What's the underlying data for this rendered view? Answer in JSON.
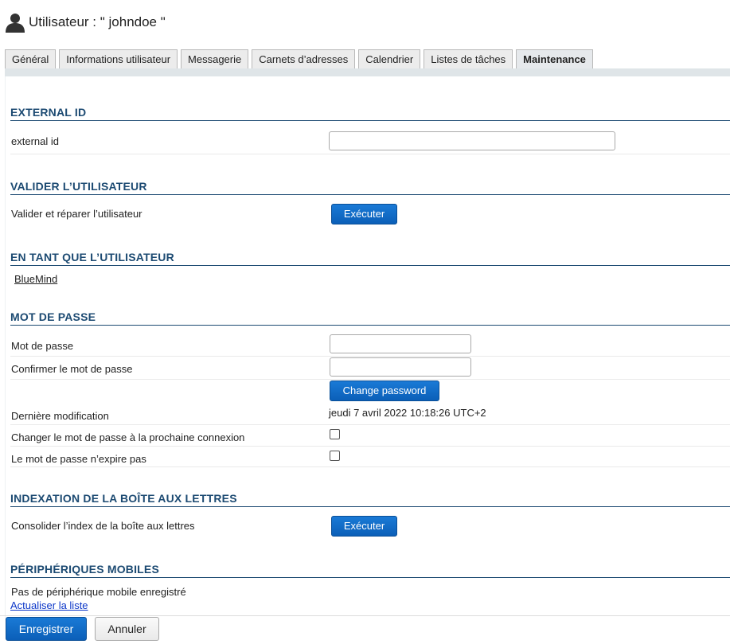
{
  "header": {
    "title": "Utilisateur : \" johndoe \"",
    "icon": "user-icon"
  },
  "tabs": [
    {
      "label": "Général"
    },
    {
      "label": "Informations utilisateur"
    },
    {
      "label": "Messagerie"
    },
    {
      "label": "Carnets d’adresses"
    },
    {
      "label": "Calendrier"
    },
    {
      "label": "Listes de tâches"
    },
    {
      "label": "Maintenance",
      "active": true
    }
  ],
  "external_id": {
    "title": "EXTERNAL ID",
    "label": "external id",
    "value": ""
  },
  "validate_user": {
    "title": "VALIDER L’UTILISATEUR",
    "label": "Valider et réparer l’utilisateur",
    "button": "Exécuter"
  },
  "as_user": {
    "title": "EN TANT QUE L’UTILISATEUR",
    "link": "BlueMind"
  },
  "password": {
    "title": "MOT DE PASSE",
    "password_label": "Mot de passe",
    "password_value": "",
    "confirm_label": "Confirmer le mot de passe",
    "confirm_value": "",
    "change_button": "Change password",
    "last_modified_label": "Dernière modification",
    "last_modified_value": "jeudi 7 avril 2022 10:18:26 UTC+2",
    "change_next_login_label": "Changer le mot de passe à la prochaine connexion",
    "change_next_login_checked": false,
    "never_expires_label": "Le mot de passe n’expire pas",
    "never_expires_checked": false
  },
  "mailbox_index": {
    "title": "INDEXATION DE LA BOÎTE AUX LETTRES",
    "label": "Consolider l’index de la boîte aux lettres",
    "button": "Exécuter"
  },
  "mobile": {
    "title": "PÉRIPHÉRIQUES MOBILES",
    "empty_text": "Pas de périphérique mobile enregistré",
    "refresh_link": "Actualiser la liste"
  },
  "footer": {
    "save": "Enregistrer",
    "cancel": "Annuler"
  },
  "colors": {
    "section_title": "#1c4a72",
    "button_blue": "#0b5fb8",
    "link_blue": "#0b36c8"
  }
}
